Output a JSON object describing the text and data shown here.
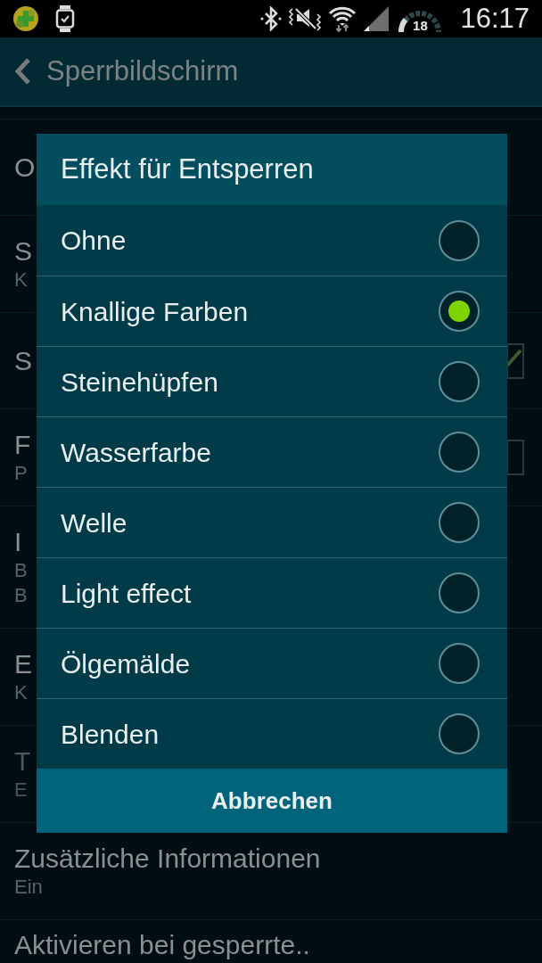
{
  "status_bar": {
    "gauge_reading": "18",
    "time": "16:17"
  },
  "header": {
    "title": "Sperrbildschirm"
  },
  "settings": [
    {
      "kind": "plain",
      "title": "O",
      "disabled": false
    },
    {
      "kind": "plain",
      "title": "S",
      "subtitle_lines": [
        "K"
      ],
      "disabled": false
    },
    {
      "kind": "checkbox",
      "title": "S",
      "checked": true,
      "disabled": false
    },
    {
      "kind": "checkbox",
      "title": "F",
      "subtitle_lines": [
        "P"
      ],
      "checked": false,
      "disabled": false
    },
    {
      "kind": "plain",
      "title": "I",
      "subtitle_lines": [
        "B",
        "B"
      ],
      "disabled": false
    },
    {
      "kind": "plain",
      "title": "E",
      "subtitle_lines": [
        "K"
      ],
      "disabled": false
    },
    {
      "kind": "plain",
      "title": "T",
      "subtitle_lines": [
        "E"
      ],
      "disabled": true
    },
    {
      "kind": "plain",
      "title": "Zusätzliche Informationen",
      "subtitle_lines": [
        "Ein"
      ],
      "disabled": false
    },
    {
      "kind": "plain",
      "title": "Aktivieren bei gesperrte..",
      "disabled": false
    }
  ],
  "dialog": {
    "title": "Effekt für Entsperren",
    "options": [
      {
        "label": "Ohne",
        "selected": false
      },
      {
        "label": "Knallige Farben",
        "selected": true
      },
      {
        "label": "Steinehüpfen",
        "selected": false
      },
      {
        "label": "Wasserfarbe",
        "selected": false
      },
      {
        "label": "Welle",
        "selected": false
      },
      {
        "label": "Light effect",
        "selected": false
      },
      {
        "label": "Ölgemälde",
        "selected": false
      },
      {
        "label": "Blenden",
        "selected": false
      }
    ],
    "button": "Abbrechen"
  }
}
